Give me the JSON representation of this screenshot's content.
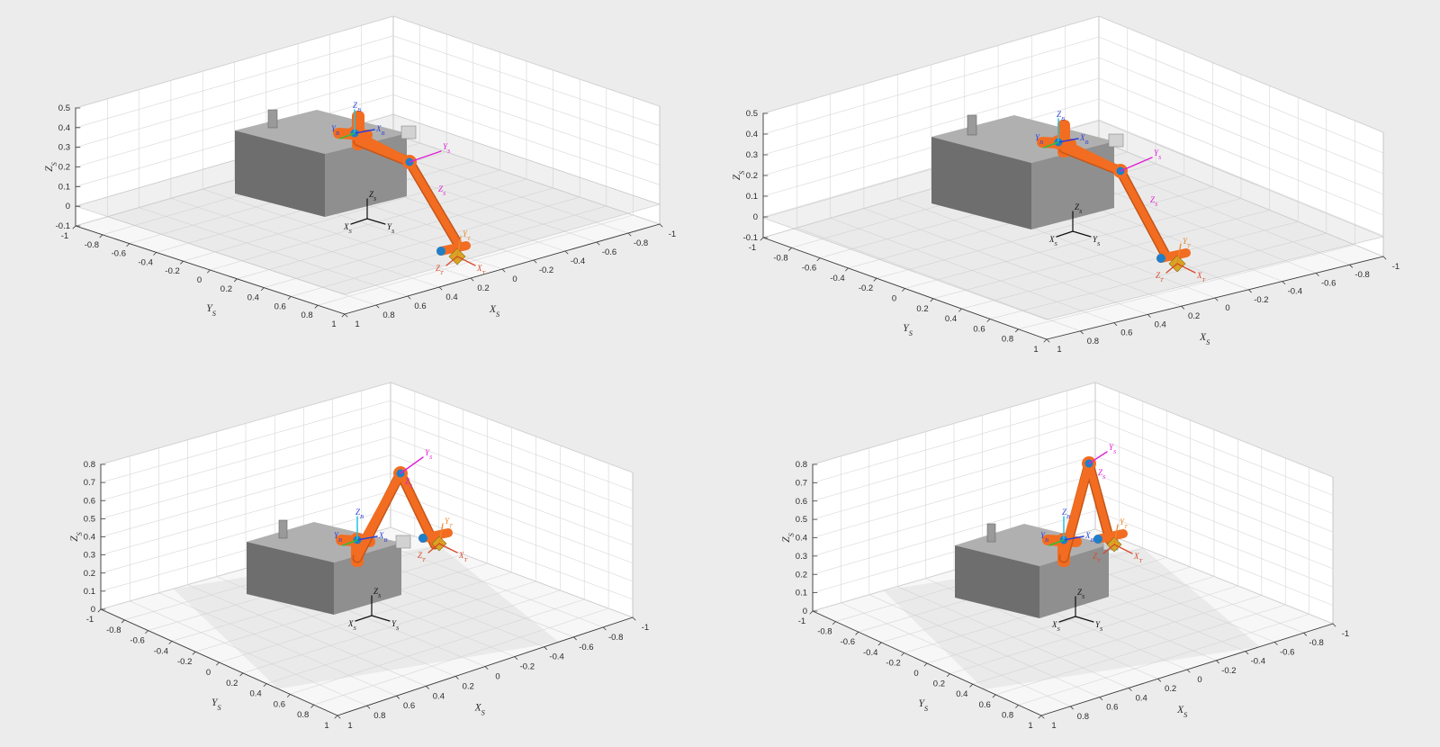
{
  "colors": {
    "background": "#ececec",
    "plane": "#ffffff",
    "grid": "#d6d6d6",
    "floor": "#e6e6e6",
    "box_top": "#b0b0b0",
    "box_front": "#6e6e6e",
    "box_side": "#8f8f8f",
    "link": "#f26d21",
    "joint": "#1e7fc8",
    "tool": "#d8a422",
    "frame_base_z": "#26c2e0",
    "frame_base_x": "#2c3fd8",
    "frame_joint": "#e01ed4",
    "frame_tool": "#e88a2b",
    "frame_tool_x": "#d84a2a"
  },
  "axes_labels": {
    "x": "X",
    "y": "Y",
    "z": "Z",
    "sub": "S"
  },
  "frame_labels": {
    "zb": "Z",
    "xb": "X",
    "yb": "Y",
    "sub_b": "B",
    "ys": "Y",
    "zs": "Z",
    "sub_s": "S",
    "yt": "Y",
    "xt": "X",
    "zt": "Z",
    "sub_t": "T"
  },
  "panels": [
    {
      "id": "top-left",
      "z_ticks": [
        "0.5",
        "0.4",
        "0.3",
        "0.2",
        "0.1",
        "0",
        "-0.1"
      ],
      "y_ticks": [
        "-1",
        "-0.8",
        "-0.6",
        "-0.4",
        "-0.2",
        "0",
        "0.2",
        "0.4",
        "0.6",
        "0.8",
        "1"
      ],
      "x_ticks": [
        "1",
        "0.8",
        "0.6",
        "0.4",
        "0.2",
        "0",
        "-0.2",
        "-0.4",
        "-0.6",
        "-0.8",
        "-1"
      ]
    },
    {
      "id": "top-right",
      "z_ticks": [
        "0.5",
        "0.4",
        "0.3",
        "0.2",
        "0.1",
        "0",
        "-0.1"
      ],
      "y_ticks": [
        "-1",
        "-0.8",
        "-0.6",
        "-0.4",
        "-0.2",
        "0",
        "0.2",
        "0.4",
        "0.6",
        "0.8",
        "1"
      ],
      "x_ticks": [
        "1",
        "0.8",
        "0.6",
        "0.4",
        "0.2",
        "0",
        "-0.2",
        "-0.4",
        "-0.6",
        "-0.8",
        "-1"
      ]
    },
    {
      "id": "bottom-left",
      "z_ticks": [
        "0.8",
        "0.7",
        "0.6",
        "0.5",
        "0.4",
        "0.3",
        "0.2",
        "0.1",
        "0"
      ],
      "y_ticks": [
        "-1",
        "-0.8",
        "-0.6",
        "-0.4",
        "-0.2",
        "0",
        "0.2",
        "0.4",
        "0.6",
        "0.8",
        "1"
      ],
      "x_ticks": [
        "1",
        "0.8",
        "0.6",
        "0.4",
        "0.2",
        "0",
        "-0.2",
        "-0.4",
        "-0.6",
        "-0.8",
        "-1"
      ]
    },
    {
      "id": "bottom-right",
      "z_ticks": [
        "0.8",
        "0.7",
        "0.6",
        "0.5",
        "0.4",
        "0.3",
        "0.2",
        "0.1",
        "0"
      ],
      "y_ticks": [
        "-1",
        "-0.8",
        "-0.6",
        "-0.4",
        "-0.2",
        "0",
        "0.2",
        "0.4",
        "0.6",
        "0.8",
        "1"
      ],
      "x_ticks": [
        "1",
        "0.8",
        "0.6",
        "0.4",
        "0.2",
        "0",
        "-0.2",
        "-0.4",
        "-0.6",
        "-0.8",
        "-1"
      ]
    }
  ]
}
